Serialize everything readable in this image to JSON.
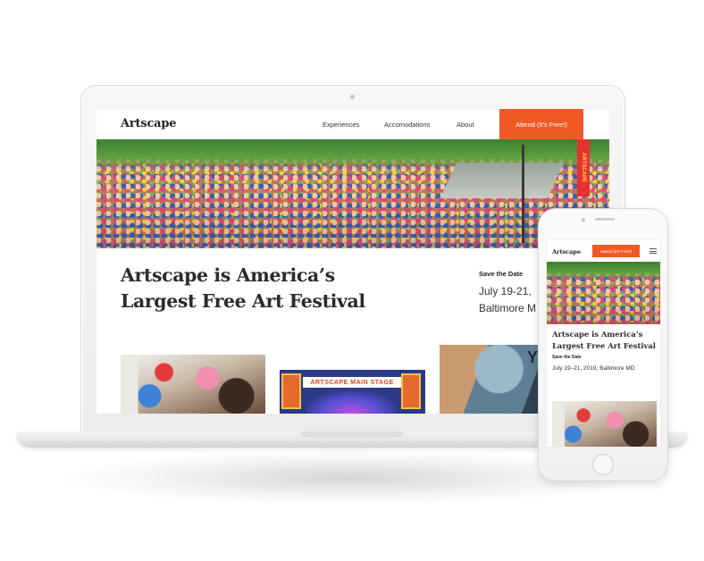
{
  "site": {
    "logo": "Artscape",
    "nav": [
      {
        "label": "Experiences"
      },
      {
        "label": "Accomodations"
      },
      {
        "label": "About"
      }
    ],
    "cta": "Attend (It's Free!)"
  },
  "hero": {
    "headline_line1": "Artscape is America’s",
    "headline_line2": "Largest Free Art Festival",
    "save_label": "Save the Date",
    "date_line1": "July 19-21,",
    "date_line2": "Baltimore M",
    "banner_text": "ARTSCAPE"
  },
  "thumbnails": {
    "stage_sign": "ARTSCAPE MAIN STAGE",
    "street_sign": "YORK"
  },
  "mobile": {
    "logo": "Artscape",
    "cta": "Attend (It's Free!)",
    "headline": "Artscape is America’s Largest Free Art Festival",
    "save_label": "Save the Date",
    "date": "July 19–21, 2019, Baltimore MD"
  },
  "colors": {
    "accent": "#f15a24",
    "text": "#2b2b2b"
  }
}
